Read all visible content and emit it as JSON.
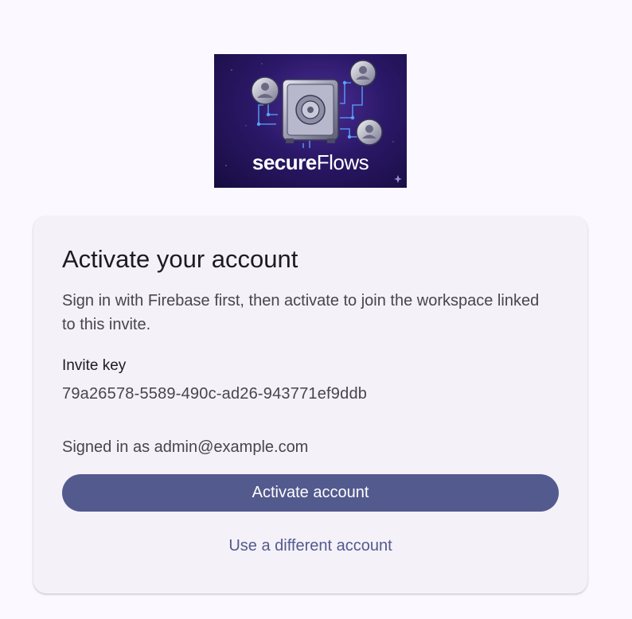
{
  "logo": {
    "name": "secureFlows",
    "text_bold": "secure",
    "text_light": "Flows",
    "icons": [
      "vault-icon",
      "user-avatar-icon"
    ]
  },
  "card": {
    "title": "Activate your account",
    "description": "Sign in with Firebase first, then activate to join the workspace linked to this invite.",
    "invite_key_label": "Invite key",
    "invite_key_value": "79a26578-5589-490c-ad26-943771ef9ddb",
    "signed_in_text": "Signed in as admin@example.com",
    "activate_button_label": "Activate account",
    "different_account_label": "Use a different account"
  },
  "colors": {
    "page_background": "#fcf8ff",
    "card_background": "#f4f1f8",
    "primary": "#535a8e",
    "on_primary": "#ffffff",
    "text_primary": "#1c1b21",
    "text_secondary": "#46464f",
    "logo_background": "#2b1868"
  }
}
